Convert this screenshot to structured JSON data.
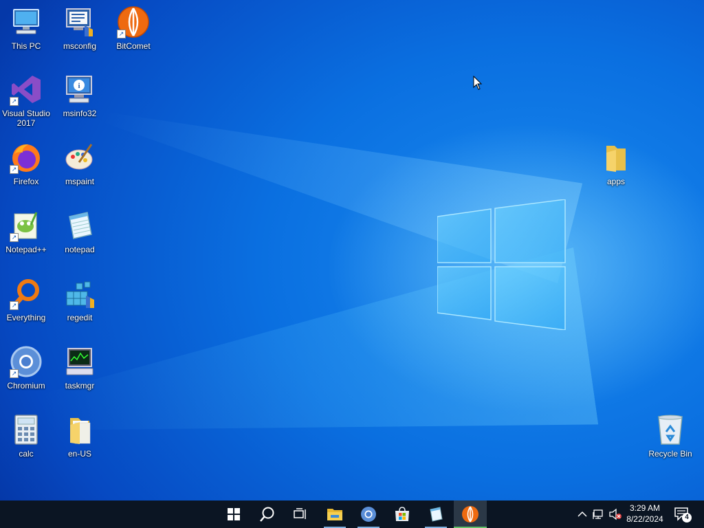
{
  "desktop": {
    "icons": [
      {
        "label": "This PC"
      },
      {
        "label": "msconfig"
      },
      {
        "label": "BitComet"
      },
      {
        "label": "Visual Studio 2017"
      },
      {
        "label": "msinfo32"
      },
      {
        "label": "Firefox"
      },
      {
        "label": "mspaint"
      },
      {
        "label": "Notepad++"
      },
      {
        "label": "notepad"
      },
      {
        "label": "Everything"
      },
      {
        "label": "regedit"
      },
      {
        "label": "Chromium"
      },
      {
        "label": "taskmgr"
      },
      {
        "label": "calc"
      },
      {
        "label": "en-US"
      },
      {
        "label": "apps"
      },
      {
        "label": "Recycle Bin"
      }
    ]
  },
  "taskbar": {
    "buttons": [
      "start-icon",
      "search-icon",
      "task-view-icon",
      "file-explorer-icon",
      "chromium-icon",
      "store-icon",
      "notepad-icon",
      "bitcomet-icon"
    ],
    "tray": [
      "chevron-up-icon",
      "network-icon",
      "volume-muted-icon"
    ],
    "clock": {
      "time": "3:29 AM",
      "date": "8/22/2024"
    },
    "notifications": {
      "count": "4"
    }
  },
  "colors": {
    "taskbar": "#0b1523",
    "desktop_accent": "#0a6fe0",
    "active_indicator": "#63c06a"
  }
}
